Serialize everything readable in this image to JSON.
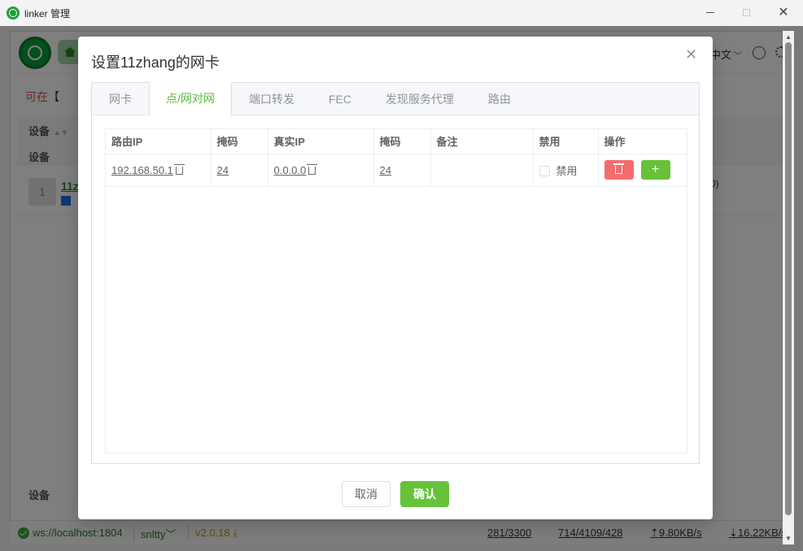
{
  "window": {
    "title": "linker 管理"
  },
  "app": {
    "lang": "中文",
    "state_prefix": "可在",
    "state_bracket": "【",
    "column_device": "设备",
    "row": {
      "index": "1",
      "name": "11z",
      "extra": "0)"
    }
  },
  "status": {
    "ws": "ws://localhost:1804",
    "user": "snltty",
    "version": "v2.0.18",
    "stat1": "281/3300",
    "stat2": "714/4109/428",
    "upload": "⇡9.80KB/s",
    "download": "⇣16.22KB/s"
  },
  "dialog": {
    "title": "设置11zhang的网卡",
    "tabs": [
      "网卡",
      "点/网对网",
      "端口转发",
      "FEC",
      "发现服务代理",
      "路由"
    ],
    "active_tab": 1,
    "table": {
      "headers": [
        "路由IP",
        "掩码",
        "真实IP",
        "掩码",
        "备注",
        "禁用",
        "操作"
      ],
      "rows": [
        {
          "route_ip": "192.168.50.1",
          "mask1": "24",
          "real_ip": "0.0.0.0",
          "mask2": "24",
          "note": "",
          "disable_label": "禁用"
        }
      ]
    },
    "cancel_label": "取消",
    "confirm_label": "确认"
  }
}
